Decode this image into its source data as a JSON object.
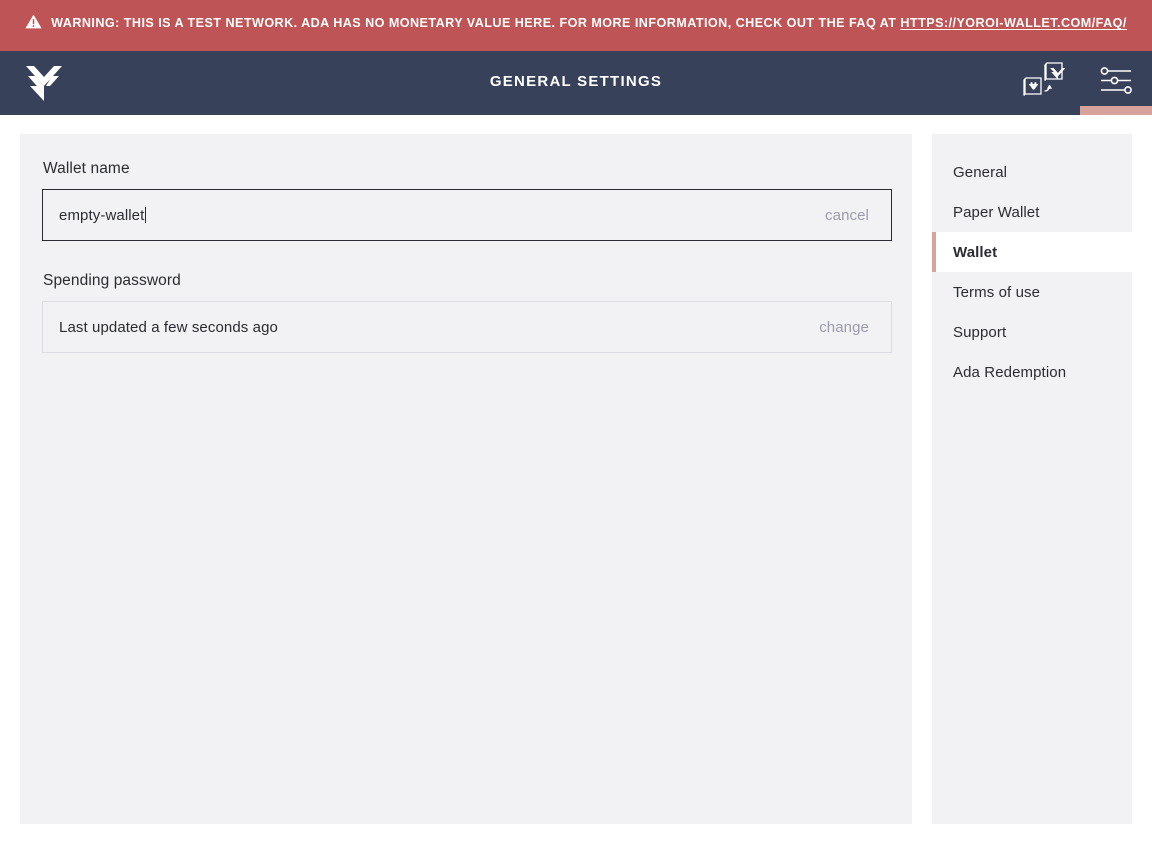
{
  "warning": {
    "icon": "warning-triangle-icon",
    "text_before_link": "Warning: this is a test network. ADA has no monetary value here. For more information, check out the FAQ at ",
    "link_text": "https://yoroi-wallet.com/faq/",
    "background_color": "#bf5456",
    "text_color": "#ffffff"
  },
  "topbar": {
    "logo": "yoroi-logo-icon",
    "title": "General Settings",
    "background_color": "#38415a",
    "accent_color": "#d7a29c",
    "actions": [
      {
        "name": "wallet-transfer-icon",
        "label": "Transfer funds",
        "active": false
      },
      {
        "name": "settings-sliders-icon",
        "label": "Settings",
        "active": true
      }
    ]
  },
  "main": {
    "wallet_name": {
      "label": "Wallet name",
      "value": "empty-wallet",
      "placeholder": "Wallet name",
      "action_label": "cancel",
      "focused": true
    },
    "spending_password": {
      "label": "Spending password",
      "value": "Last updated a few seconds ago",
      "action_label": "change"
    }
  },
  "sidebar": {
    "items": [
      {
        "label": "General",
        "active": false
      },
      {
        "label": "Paper Wallet",
        "active": false
      },
      {
        "label": "Wallet",
        "active": true
      },
      {
        "label": "Terms of use",
        "active": false
      },
      {
        "label": "Support",
        "active": false
      },
      {
        "label": "Ada Redemption",
        "active": false
      }
    ]
  }
}
